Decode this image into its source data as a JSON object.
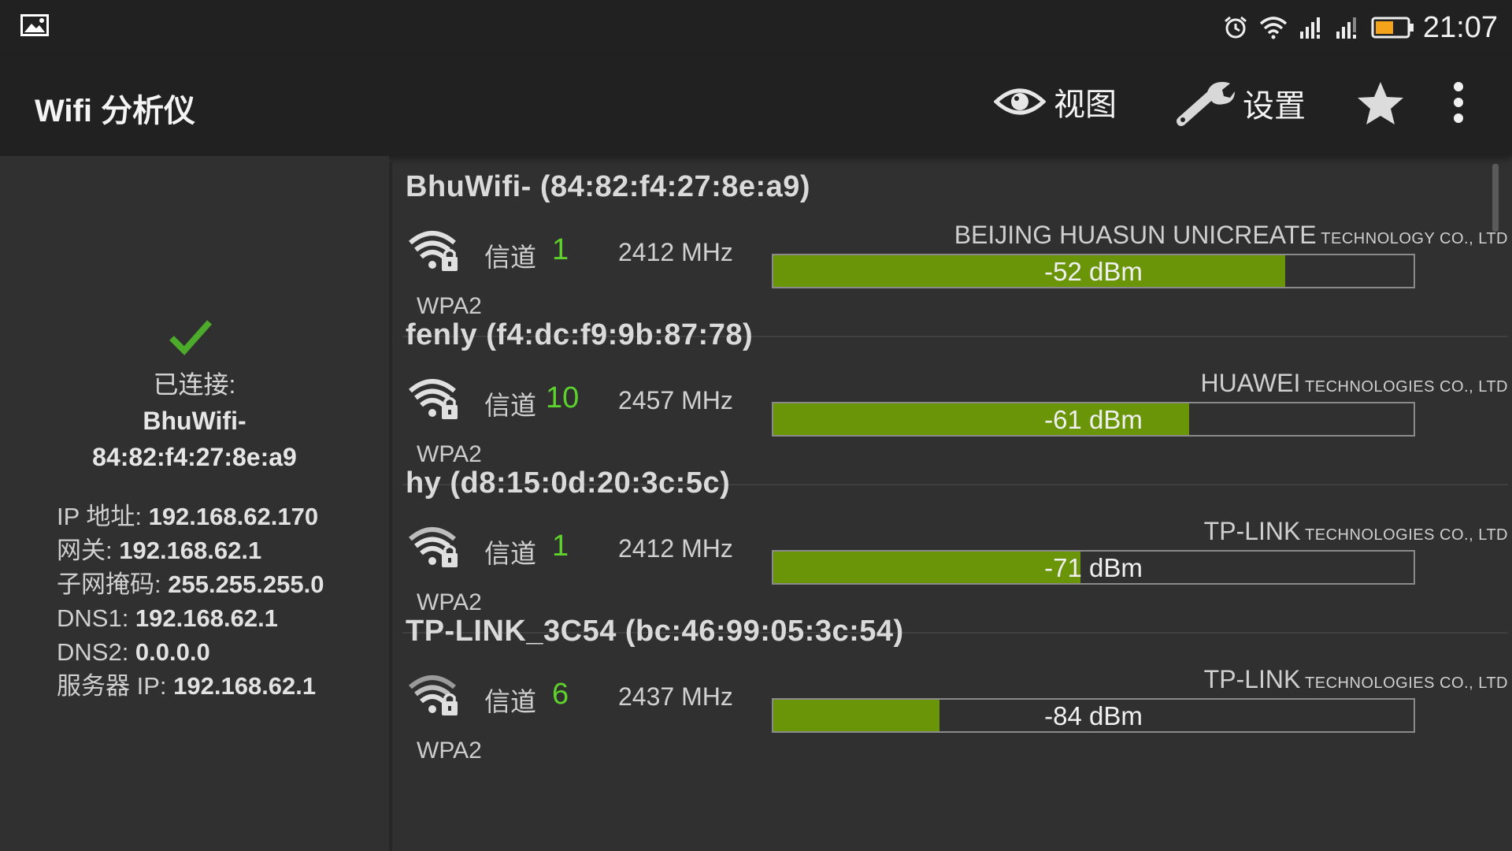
{
  "status_bar": {
    "time": "21:07",
    "icons": [
      "image-icon",
      "alarm-icon",
      "wifi-icon",
      "signal-icon",
      "signal-icon",
      "battery-icon"
    ]
  },
  "app_bar": {
    "title": "Wifi 分析仪",
    "view_label": "视图",
    "settings_label": "设置"
  },
  "connection": {
    "status": "已连接:",
    "ssid": "BhuWifi-",
    "bssid": "84:82:f4:27:8e:a9",
    "info": [
      {
        "label": "IP 地址: ",
        "value": "192.168.62.170"
      },
      {
        "label": "网关: ",
        "value": "192.168.62.1"
      },
      {
        "label": "子网掩码: ",
        "value": "255.255.255.0"
      },
      {
        "label": "DNS1: ",
        "value": "192.168.62.1"
      },
      {
        "label": "DNS2: ",
        "value": "0.0.0.0"
      },
      {
        "label": "服务器 IP: ",
        "value": "192.168.62.1"
      }
    ]
  },
  "access_points": [
    {
      "title": "BhuWifi- (84:82:f4:27:8e:a9)",
      "channel_label": "信道",
      "channel": "1",
      "freq": "2412 MHz",
      "security": "WPA2",
      "vendor_main": "BEIJING HUASUN UNICREATE",
      "vendor_suffix": " TECHNOLOGY CO., LTD",
      "dbm": "-52 dBm",
      "strength_pct": 80
    },
    {
      "title": "fenly (f4:dc:f9:9b:87:78)",
      "channel_label": "信道",
      "channel": "10",
      "freq": "2457 MHz",
      "security": "WPA2",
      "vendor_main": "HUAWEI",
      "vendor_suffix": " TECHNOLOGIES CO., LTD",
      "dbm": "-61 dBm",
      "strength_pct": 65
    },
    {
      "title": "hy (d8:15:0d:20:3c:5c)",
      "channel_label": "信道",
      "channel": "1",
      "freq": "2412 MHz",
      "security": "WPA2",
      "vendor_main": "TP-LINK",
      "vendor_suffix": " TECHNOLOGIES CO., LTD",
      "dbm": "-71 dBm",
      "strength_pct": 48
    },
    {
      "title": "TP-LINK_3C54 (bc:46:99:05:3c:54)",
      "channel_label": "信道",
      "channel": "6",
      "freq": "2437 MHz",
      "security": "WPA2",
      "vendor_main": "TP-LINK",
      "vendor_suffix": " TECHNOLOGIES CO., LTD",
      "dbm": "-84 dBm",
      "strength_pct": 26
    }
  ]
}
